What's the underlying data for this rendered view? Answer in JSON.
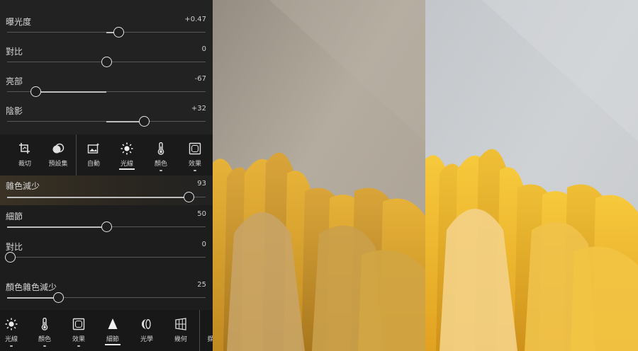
{
  "light_sliders": [
    {
      "label": "曝光度",
      "value": "+0.47",
      "level": 0.47,
      "range": [
        -5,
        5
      ]
    },
    {
      "label": "對比",
      "value": "0",
      "level": 0,
      "range": [
        -100,
        100
      ]
    },
    {
      "label": "亮部",
      "value": "-67",
      "level": -67,
      "range": [
        -100,
        100
      ]
    },
    {
      "label": "陰影",
      "value": "+32",
      "level": 32,
      "range": [
        -100,
        100
      ]
    }
  ],
  "top_toolbar": {
    "tools": [
      {
        "label": "裁切",
        "icon": "crop-icon"
      },
      {
        "label": "預設集",
        "icon": "presets-icon"
      },
      {
        "label": "自動",
        "icon": "auto-icon"
      },
      {
        "label": "光線",
        "icon": "light-icon",
        "active": true
      },
      {
        "label": "顏色",
        "icon": "thermometer-icon"
      },
      {
        "label": "效果",
        "icon": "effects-icon"
      }
    ]
  },
  "detail_sliders": [
    {
      "label": "雜色減少",
      "value": "93",
      "level": 93,
      "range": [
        0,
        100
      ],
      "highlight": true
    },
    {
      "label": "細節",
      "value": "50",
      "level": 50,
      "range": [
        0,
        100
      ]
    },
    {
      "label": "對比",
      "value": "0",
      "level": 0,
      "range": [
        0,
        100
      ]
    },
    {
      "label": "顏色雜色減少",
      "value": "25",
      "level": 25,
      "range": [
        0,
        100
      ]
    }
  ],
  "bottom_toolbar": {
    "tools": [
      {
        "label": "光線",
        "icon": "light-icon"
      },
      {
        "label": "顏色",
        "icon": "thermometer-icon"
      },
      {
        "label": "效果",
        "icon": "effects-icon"
      },
      {
        "label": "細節",
        "icon": "detail-icon",
        "active": true
      },
      {
        "label": "光學",
        "icon": "optics-icon"
      },
      {
        "label": "幾何",
        "icon": "geometry-icon"
      },
      {
        "label": "擷",
        "icon": "partial-icon"
      }
    ]
  },
  "colors": {
    "accent": "#e8e8e8",
    "petal_light": "#f3c43c",
    "petal_dark": "#d79a1c",
    "bg_warm": "#a19a8e",
    "bg_cool": "#c7c9cc"
  }
}
